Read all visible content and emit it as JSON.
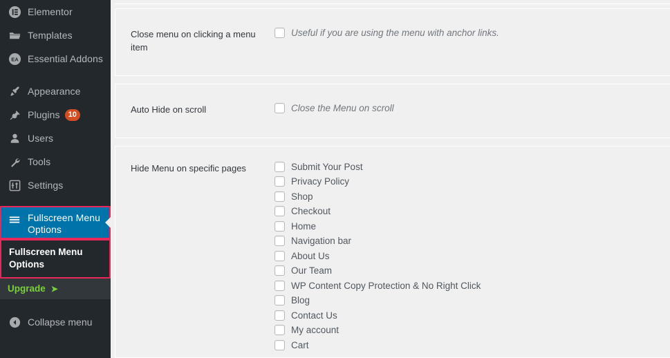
{
  "sidebar": {
    "items": [
      {
        "label": "Elementor",
        "icon": "elementor-icon"
      },
      {
        "label": "Templates",
        "icon": "folder-icon"
      },
      {
        "label": "Essential Addons",
        "icon": "essential-addons-icon"
      },
      {
        "label": "Appearance",
        "icon": "paintbrush-icon"
      },
      {
        "label": "Plugins",
        "icon": "plug-icon",
        "badge": "10"
      },
      {
        "label": "Users",
        "icon": "user-icon"
      },
      {
        "label": "Tools",
        "icon": "wrench-icon"
      },
      {
        "label": "Settings",
        "icon": "sliders-icon"
      }
    ],
    "active_item": {
      "label": "Fullscreen Menu Options",
      "icon": "hamburger-icon"
    },
    "submenu_item": {
      "label": "Fullscreen Menu Options"
    },
    "upgrade": {
      "label": "Upgrade",
      "arrow": "➤"
    },
    "collapse": {
      "label": "Collapse menu",
      "icon": "collapse-arrow-icon"
    },
    "colors": {
      "background": "#23282d",
      "active_background": "#0073aa",
      "highlight_border": "#e8275a",
      "badge_background": "#d54e21",
      "upgrade_text": "#7ad03a"
    }
  },
  "main": {
    "settings": [
      {
        "label": "Close menu on clicking a menu item",
        "checkbox_checked": false,
        "description": "Useful if you are using the menu with anchor links."
      },
      {
        "label": "Auto Hide on scroll",
        "checkbox_checked": false,
        "description": "Close the Menu on scroll"
      }
    ],
    "hide_menu_section": {
      "label": "Hide Menu on specific pages",
      "pages": [
        {
          "label": "Submit Your Post",
          "checked": false
        },
        {
          "label": "Privacy Policy",
          "checked": false
        },
        {
          "label": "Shop",
          "checked": false
        },
        {
          "label": "Checkout",
          "checked": false
        },
        {
          "label": "Home",
          "checked": false
        },
        {
          "label": "Navigation bar",
          "checked": false
        },
        {
          "label": "About Us",
          "checked": false
        },
        {
          "label": "Our Team",
          "checked": false
        },
        {
          "label": "WP Content Copy Protection & No Right Click",
          "checked": false
        },
        {
          "label": "Blog",
          "checked": false
        },
        {
          "label": "Contact Us",
          "checked": false
        },
        {
          "label": "My account",
          "checked": false
        },
        {
          "label": "Cart",
          "checked": false
        }
      ]
    }
  }
}
